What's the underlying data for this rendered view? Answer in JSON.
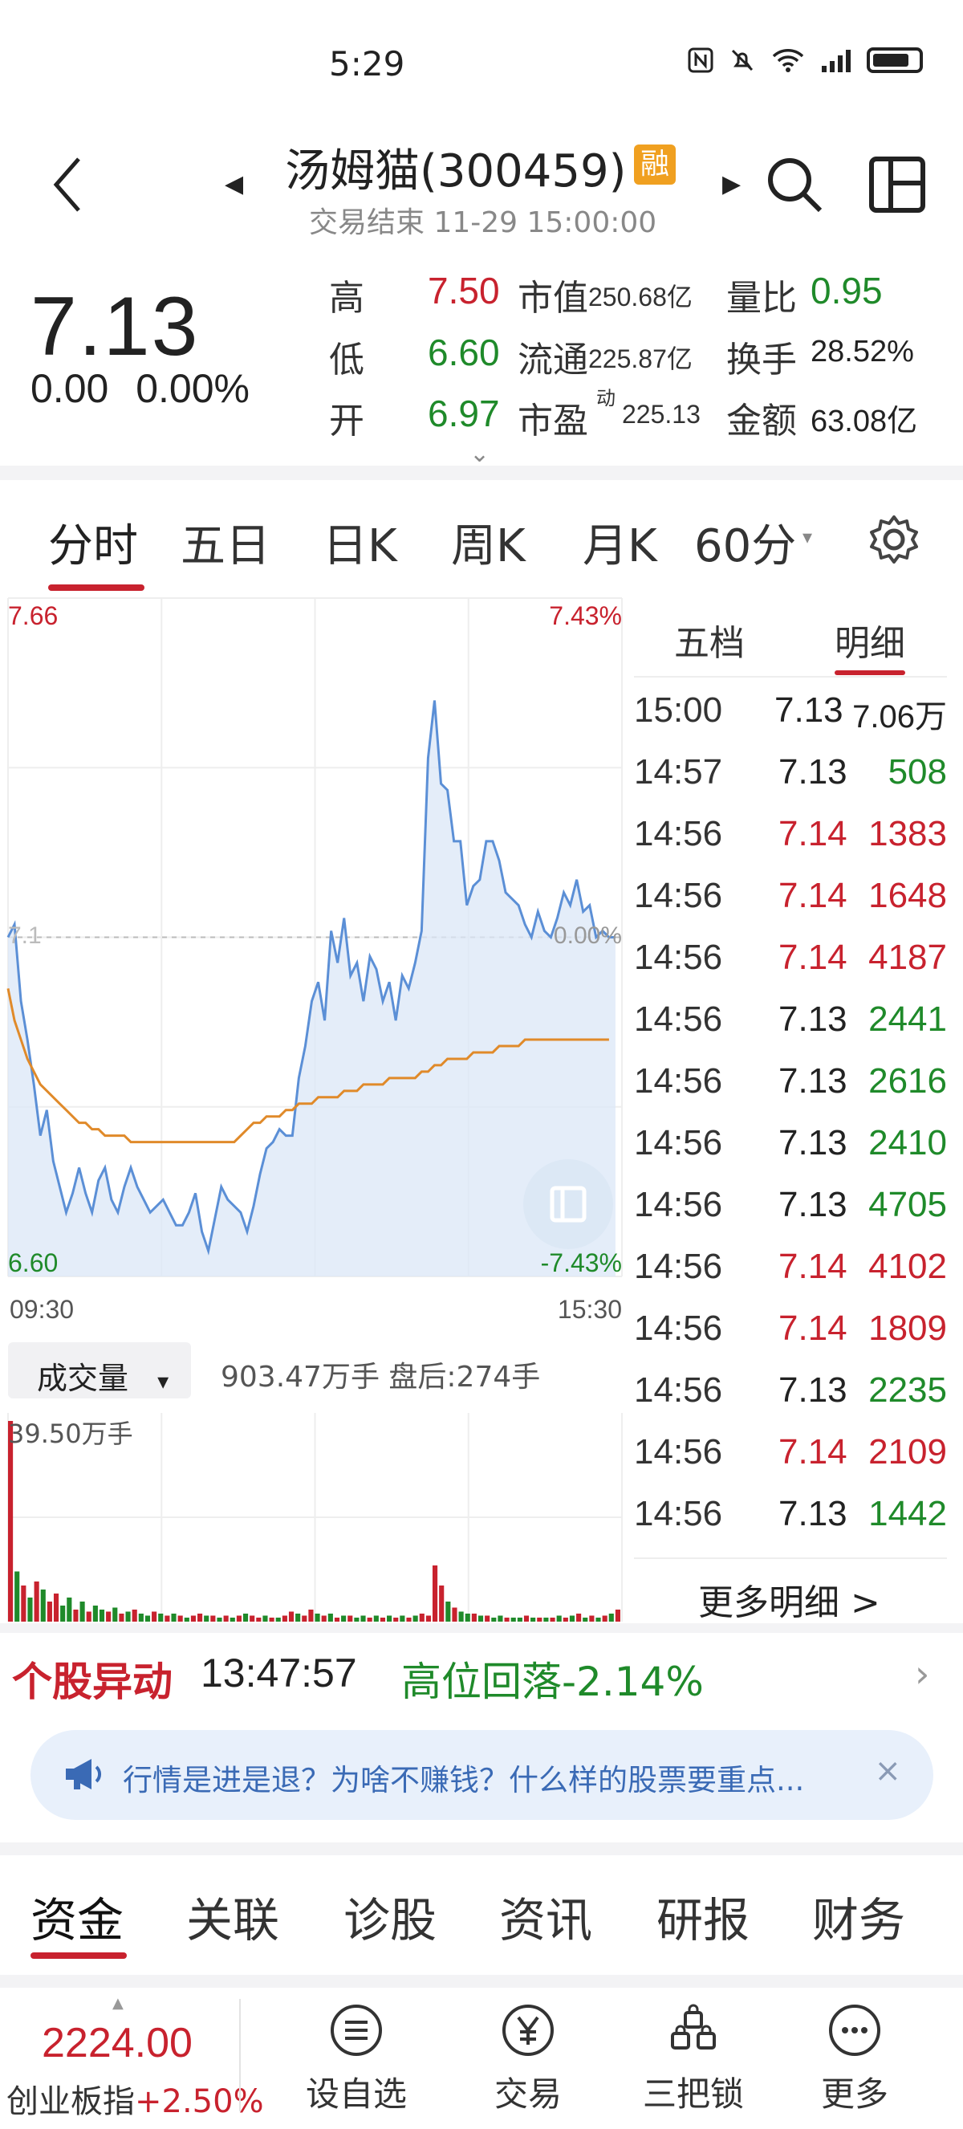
{
  "status_bar": {
    "time": "5:29",
    "icons": [
      "nfc-icon",
      "mute-icon",
      "wifi-icon",
      "signal-icon",
      "battery-icon"
    ]
  },
  "header": {
    "title": "汤姆猫(300459)",
    "badge": "融",
    "subtitle": "交易结束 11-29 15:00:00"
  },
  "quote": {
    "price": "7.13",
    "change": "0.00",
    "change_pct": "0.00%",
    "rows": [
      {
        "l1": "高",
        "v1": "7.50",
        "c1": "red",
        "l2": "市值",
        "v2": "250.68亿",
        "l3": "量比",
        "v3": "0.95",
        "c3": "green"
      },
      {
        "l1": "低",
        "v1": "6.60",
        "c1": "green",
        "l2": "流通",
        "v2": "225.87亿",
        "l3": "换手",
        "v3": "28.52%",
        "c3": "dark"
      },
      {
        "l1": "开",
        "v1": "6.97",
        "c1": "green",
        "l2": "市盈",
        "sup": "动",
        "v2": "225.13",
        "l3": "金额",
        "v3": "63.08亿",
        "c3": "dark"
      }
    ]
  },
  "chart_tabs": [
    "分时",
    "五日",
    "日K",
    "周K",
    "月K",
    "60分"
  ],
  "chart_data": {
    "type": "line",
    "title": "",
    "xlabel": "",
    "ylabel": "",
    "x_range": [
      "09:30",
      "15:30"
    ],
    "ylim": [
      6.6,
      7.66
    ],
    "pct_range": [
      "-7.43%",
      "7.43%"
    ],
    "labels": {
      "top_left": "7.66",
      "bottom_left": "6.60",
      "top_right": "7.43%",
      "bottom_right": "-7.43%",
      "mid_left": "7.1",
      "mid_right": "0.00%",
      "x_start": "09:30",
      "x_end": "15:30"
    },
    "price_series": [
      7.13,
      7.15,
      7.03,
      6.97,
      6.9,
      6.82,
      6.86,
      6.78,
      6.74,
      6.7,
      6.73,
      6.77,
      6.73,
      6.7,
      6.75,
      6.77,
      6.72,
      6.7,
      6.74,
      6.77,
      6.74,
      6.72,
      6.7,
      6.71,
      6.72,
      6.7,
      6.68,
      6.68,
      6.7,
      6.73,
      6.67,
      6.64,
      6.69,
      6.74,
      6.72,
      6.71,
      6.7,
      6.67,
      6.71,
      6.76,
      6.8,
      6.81,
      6.83,
      6.82,
      6.82,
      6.91,
      6.96,
      7.03,
      7.06,
      7.0,
      7.14,
      7.09,
      7.16,
      7.07,
      7.09,
      7.03,
      7.1,
      7.08,
      7.03,
      7.06,
      7.0,
      7.07,
      7.05,
      7.09,
      7.14,
      7.41,
      7.5,
      7.37,
      7.36,
      7.28,
      7.28,
      7.18,
      7.21,
      7.22,
      7.28,
      7.28,
      7.25,
      7.2,
      7.19,
      7.18,
      7.15,
      7.13,
      7.17,
      7.14,
      7.13,
      7.16,
      7.2,
      7.18,
      7.22,
      7.17,
      7.18,
      7.13,
      7.14,
      7.13,
      7.13
    ],
    "avg_series": [
      7.05,
      7.0,
      6.97,
      6.94,
      6.92,
      6.9,
      6.89,
      6.88,
      6.87,
      6.86,
      6.85,
      6.84,
      6.84,
      6.83,
      6.83,
      6.82,
      6.82,
      6.82,
      6.82,
      6.81,
      6.81,
      6.81,
      6.81,
      6.81,
      6.81,
      6.81,
      6.81,
      6.81,
      6.81,
      6.81,
      6.81,
      6.81,
      6.81,
      6.81,
      6.81,
      6.81,
      6.82,
      6.83,
      6.84,
      6.84,
      6.85,
      6.85,
      6.85,
      6.86,
      6.86,
      6.87,
      6.87,
      6.87,
      6.88,
      6.88,
      6.88,
      6.88,
      6.89,
      6.89,
      6.89,
      6.9,
      6.9,
      6.9,
      6.9,
      6.91,
      6.91,
      6.91,
      6.91,
      6.91,
      6.92,
      6.92,
      6.93,
      6.93,
      6.94,
      6.94,
      6.94,
      6.94,
      6.95,
      6.95,
      6.95,
      6.95,
      6.96,
      6.96,
      6.96,
      6.96,
      6.97,
      6.97,
      6.97,
      6.97,
      6.97,
      6.97,
      6.97,
      6.97,
      6.97,
      6.97,
      6.97,
      6.97,
      6.97,
      6.97
    ],
    "volume": {
      "max_label": "39.50万手",
      "total": "903.47万手 盘后:274手",
      "bars": [
        1.0,
        0.25,
        0.18,
        0.12,
        0.2,
        0.16,
        0.1,
        0.14,
        0.08,
        0.12,
        0.06,
        0.1,
        0.05,
        0.08,
        0.06,
        0.05,
        0.07,
        0.04,
        0.05,
        0.06,
        0.04,
        0.03,
        0.05,
        0.04,
        0.03,
        0.04,
        0.03,
        0.02,
        0.03,
        0.04,
        0.03,
        0.03,
        0.02,
        0.03,
        0.02,
        0.03,
        0.04,
        0.03,
        0.02,
        0.03,
        0.02,
        0.02,
        0.03,
        0.05,
        0.04,
        0.03,
        0.06,
        0.04,
        0.03,
        0.04,
        0.02,
        0.03,
        0.03,
        0.02,
        0.03,
        0.02,
        0.03,
        0.02,
        0.03,
        0.02,
        0.03,
        0.02,
        0.03,
        0.04,
        0.03,
        0.28,
        0.18,
        0.1,
        0.07,
        0.05,
        0.04,
        0.04,
        0.03,
        0.03,
        0.02,
        0.03,
        0.02,
        0.02,
        0.02,
        0.03,
        0.02,
        0.02,
        0.02,
        0.02,
        0.03,
        0.02,
        0.03,
        0.04,
        0.02,
        0.03,
        0.02,
        0.03,
        0.04,
        0.06
      ],
      "bar_colors": [
        "r",
        "g",
        "r",
        "g",
        "r",
        "g",
        "r",
        "r",
        "g",
        "g",
        "r",
        "g",
        "r",
        "g",
        "g",
        "r",
        "g",
        "r",
        "g",
        "r",
        "g",
        "g",
        "r",
        "g",
        "r",
        "g",
        "r",
        "g",
        "r",
        "r",
        "g",
        "r",
        "g",
        "r",
        "g",
        "r",
        "g",
        "r",
        "r",
        "g",
        "r",
        "g",
        "r",
        "r",
        "g",
        "r",
        "r",
        "g",
        "r",
        "g",
        "r",
        "g",
        "r",
        "g",
        "g",
        "r",
        "g",
        "r",
        "g",
        "r",
        "g",
        "r",
        "g",
        "r",
        "r",
        "r",
        "r",
        "g",
        "r",
        "g",
        "g",
        "r",
        "g",
        "r",
        "g",
        "g",
        "r",
        "g",
        "g",
        "r",
        "g",
        "r",
        "g",
        "r",
        "g",
        "r",
        "g",
        "r",
        "g",
        "r",
        "g",
        "r",
        "g",
        "r"
      ]
    }
  },
  "detail_panel": {
    "tabs": [
      "五档",
      "明细"
    ],
    "rows": [
      {
        "time": "15:00",
        "price": "7.13",
        "vol": "7.06万",
        "pc": "dark",
        "vc": "dark"
      },
      {
        "time": "14:57",
        "price": "7.13",
        "vol": "508",
        "pc": "dark",
        "vc": "green"
      },
      {
        "time": "14:56",
        "price": "7.14",
        "vol": "1383",
        "pc": "red",
        "vc": "red"
      },
      {
        "time": "14:56",
        "price": "7.14",
        "vol": "1648",
        "pc": "red",
        "vc": "red"
      },
      {
        "time": "14:56",
        "price": "7.14",
        "vol": "4187",
        "pc": "red",
        "vc": "red"
      },
      {
        "time": "14:56",
        "price": "7.13",
        "vol": "2441",
        "pc": "dark",
        "vc": "green"
      },
      {
        "time": "14:56",
        "price": "7.13",
        "vol": "2616",
        "pc": "dark",
        "vc": "green"
      },
      {
        "time": "14:56",
        "price": "7.13",
        "vol": "2410",
        "pc": "dark",
        "vc": "green"
      },
      {
        "time": "14:56",
        "price": "7.13",
        "vol": "4705",
        "pc": "dark",
        "vc": "green"
      },
      {
        "time": "14:56",
        "price": "7.14",
        "vol": "4102",
        "pc": "red",
        "vc": "red"
      },
      {
        "time": "14:56",
        "price": "7.14",
        "vol": "1809",
        "pc": "red",
        "vc": "red"
      },
      {
        "time": "14:56",
        "price": "7.13",
        "vol": "2235",
        "pc": "dark",
        "vc": "green"
      },
      {
        "time": "14:56",
        "price": "7.14",
        "vol": "2109",
        "pc": "red",
        "vc": "red"
      },
      {
        "time": "14:56",
        "price": "7.13",
        "vol": "1442",
        "pc": "dark",
        "vc": "green"
      }
    ],
    "more_label": "更多明细 >"
  },
  "volume_select": {
    "label": "成交量",
    "arrow": "▾"
  },
  "alert": {
    "label": "个股异动",
    "time": "13:47:57",
    "text": "高位回落-2.14%"
  },
  "notice": {
    "text": "行情是进是退？为啥不赚钱？什么样的股票要重点...",
    "close": "×"
  },
  "bottom_tabs": [
    "资金",
    "关联",
    "诊股",
    "资讯",
    "研报",
    "财务"
  ],
  "bottom_nav": {
    "index_value": "2224.00",
    "index_name": "创业板指",
    "index_change": "+2.50%",
    "items": [
      "设自选",
      "交易",
      "三把锁",
      "更多"
    ]
  },
  "colors": {
    "up": "#c8222e",
    "down": "#1f8a2a",
    "line": "#5b8fd6",
    "avg": "#e08a2a",
    "fill": "#dbe7f7"
  }
}
